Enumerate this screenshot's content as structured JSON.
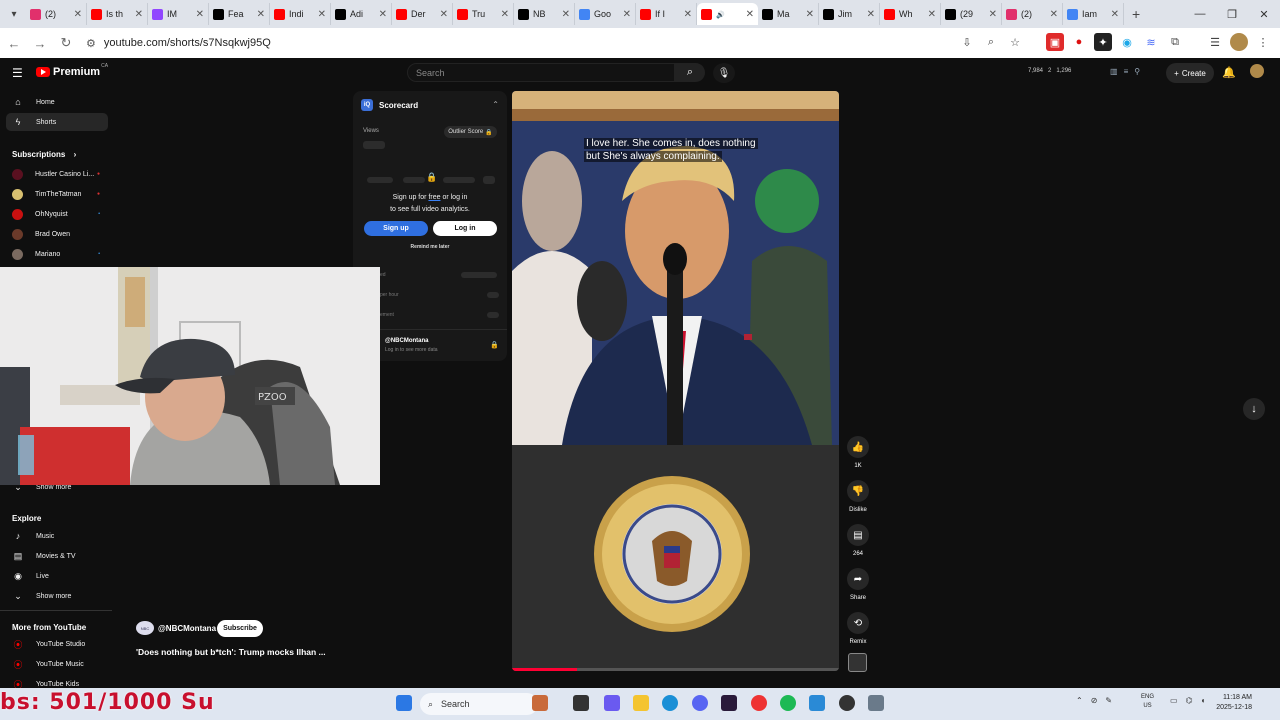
{
  "browser": {
    "tabs": [
      {
        "label": "(2)",
        "color": "#e1306c",
        "active": false
      },
      {
        "label": "Is th",
        "color": "#ff0000",
        "active": false
      },
      {
        "label": "IM",
        "color": "#9146ff",
        "active": false
      },
      {
        "label": "Fea",
        "color": "#000000",
        "active": false
      },
      {
        "label": "Indi",
        "color": "#ff0000",
        "active": false
      },
      {
        "label": "Adi",
        "color": "#000000",
        "active": false
      },
      {
        "label": "Der",
        "color": "#ff0000",
        "active": false
      },
      {
        "label": "Tru",
        "color": "#ff0000",
        "active": false
      },
      {
        "label": "NB",
        "color": "#000000",
        "active": false
      },
      {
        "label": "Goo",
        "color": "#4285f4",
        "active": false
      },
      {
        "label": "If I",
        "color": "#ff0000",
        "active": false
      },
      {
        "label": "",
        "color": "#ff0000",
        "active": true
      },
      {
        "label": "Ma",
        "color": "#000000",
        "active": false
      },
      {
        "label": "Jim",
        "color": "#000000",
        "active": false
      },
      {
        "label": "Wh",
        "color": "#ff0000",
        "active": false
      },
      {
        "label": "(29",
        "color": "#000000",
        "active": false
      },
      {
        "label": "(2)",
        "color": "#e1306c",
        "active": false
      },
      {
        "label": "Iam",
        "color": "#4285f4",
        "active": false
      }
    ],
    "url": "youtube.com/shorts/s7Nsqkwj95Q"
  },
  "header": {
    "logo_text": "Premium",
    "logo_region": "CA",
    "search_placeholder": "Search",
    "stats": [
      "7,984",
      "2",
      "1,296"
    ],
    "create_label": "Create"
  },
  "sidebar": {
    "top": [
      {
        "label": "Home",
        "icon": "home-icon"
      },
      {
        "label": "Shorts",
        "icon": "shorts-icon"
      }
    ],
    "subscriptions_title": "Subscriptions",
    "subscriptions": [
      {
        "label": "Hustler Casino Li...",
        "color": "#5a1020"
      },
      {
        "label": "TimTheTatman",
        "color": "#d8c070"
      },
      {
        "label": "OhNyquist",
        "color": "#c81010"
      },
      {
        "label": "Brad Owen",
        "color": "#6a3a2a"
      },
      {
        "label": "Mariano",
        "color": "#7a6a60"
      }
    ],
    "show_more_1": "Show more",
    "explore_title": "Explore",
    "explore": [
      {
        "label": "Music",
        "icon": "music-icon"
      },
      {
        "label": "Movies & TV",
        "icon": "movies-icon"
      },
      {
        "label": "Live",
        "icon": "live-icon"
      }
    ],
    "show_more_2": "Show more",
    "more_title": "More from YouTube",
    "more": [
      {
        "label": "YouTube Studio"
      },
      {
        "label": "YouTube Music"
      },
      {
        "label": "YouTube Kids"
      }
    ]
  },
  "scorecard": {
    "title": "Scorecard",
    "views_label": "Views",
    "outlier_label": "Outlier Score",
    "signup_text_1": "Sign up for",
    "signup_free": "free",
    "signup_text_2": "or log in",
    "signup_text_3": "to see full video analytics.",
    "signup_btn": "Sign up",
    "login_btn": "Log in",
    "remind": "Remind me later",
    "row_labels": [
      "ed",
      "per hour",
      "ement"
    ],
    "channel": "@NBCMontana",
    "channel_sub": "Log in to see more data"
  },
  "video": {
    "caption_line1": "I love her. She comes in, does nothing",
    "caption_line2": "but She's always complaining.",
    "seal_text": "SEAL OF THE PRESIDENT OF THE UNITED STATES",
    "progress": 0.2
  },
  "actions": {
    "like_count": "1K",
    "dislike_label": "Dislike",
    "comment_count": "264",
    "share_label": "Share",
    "remix_label": "Remix"
  },
  "meta": {
    "channel": "@NBCMontana",
    "subscribe_label": "Subscribe",
    "title": "'Does nothing but b*tch': Trump mocks Ilhan ..."
  },
  "taskbar": {
    "search_label": "Search",
    "lang_line1": "ENG",
    "lang_line2": "US",
    "time": "11:18 AM",
    "date": "2025-12-18"
  },
  "overlay_counter": "bs: 501/1000  Su"
}
